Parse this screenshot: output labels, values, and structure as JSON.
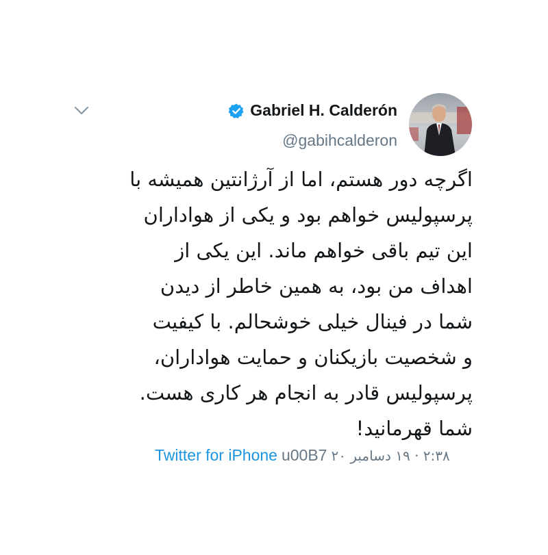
{
  "tweet": {
    "author": {
      "name": "Gabriel H. Calderón",
      "handle": "@gabihcalderon",
      "verified": true
    },
    "body_lines": [
      "اگرچه دور هستم، اما از آرژانتین همیشه با",
      "پرسپولیس خواهم بود و یکی از هواداران",
      "این تیم باقی خواهم ماند. این یکی از",
      "اهداف من بود، به همین خاطر از دیدن",
      "شما در فینال خیلی خوشحالم. با کیفیت",
      "و شخصیت بازیکنان و حمایت هواداران،",
      "پرسپولیس قادر به انجام هر کاری هست.",
      "شما قهرمانید!"
    ],
    "timestamp": "۲:۳۸ · ۱۹ دسامبر ۲۰",
    "separator": "u00B7",
    "source": "Twitter for iPhone"
  },
  "icons": {
    "verified": "verified-badge-icon",
    "chevron": "chevron-down-icon"
  },
  "colors": {
    "link": "#1b95e0",
    "secondary_text": "#657786",
    "verified": "#1da1f2",
    "text": "#14171a"
  }
}
